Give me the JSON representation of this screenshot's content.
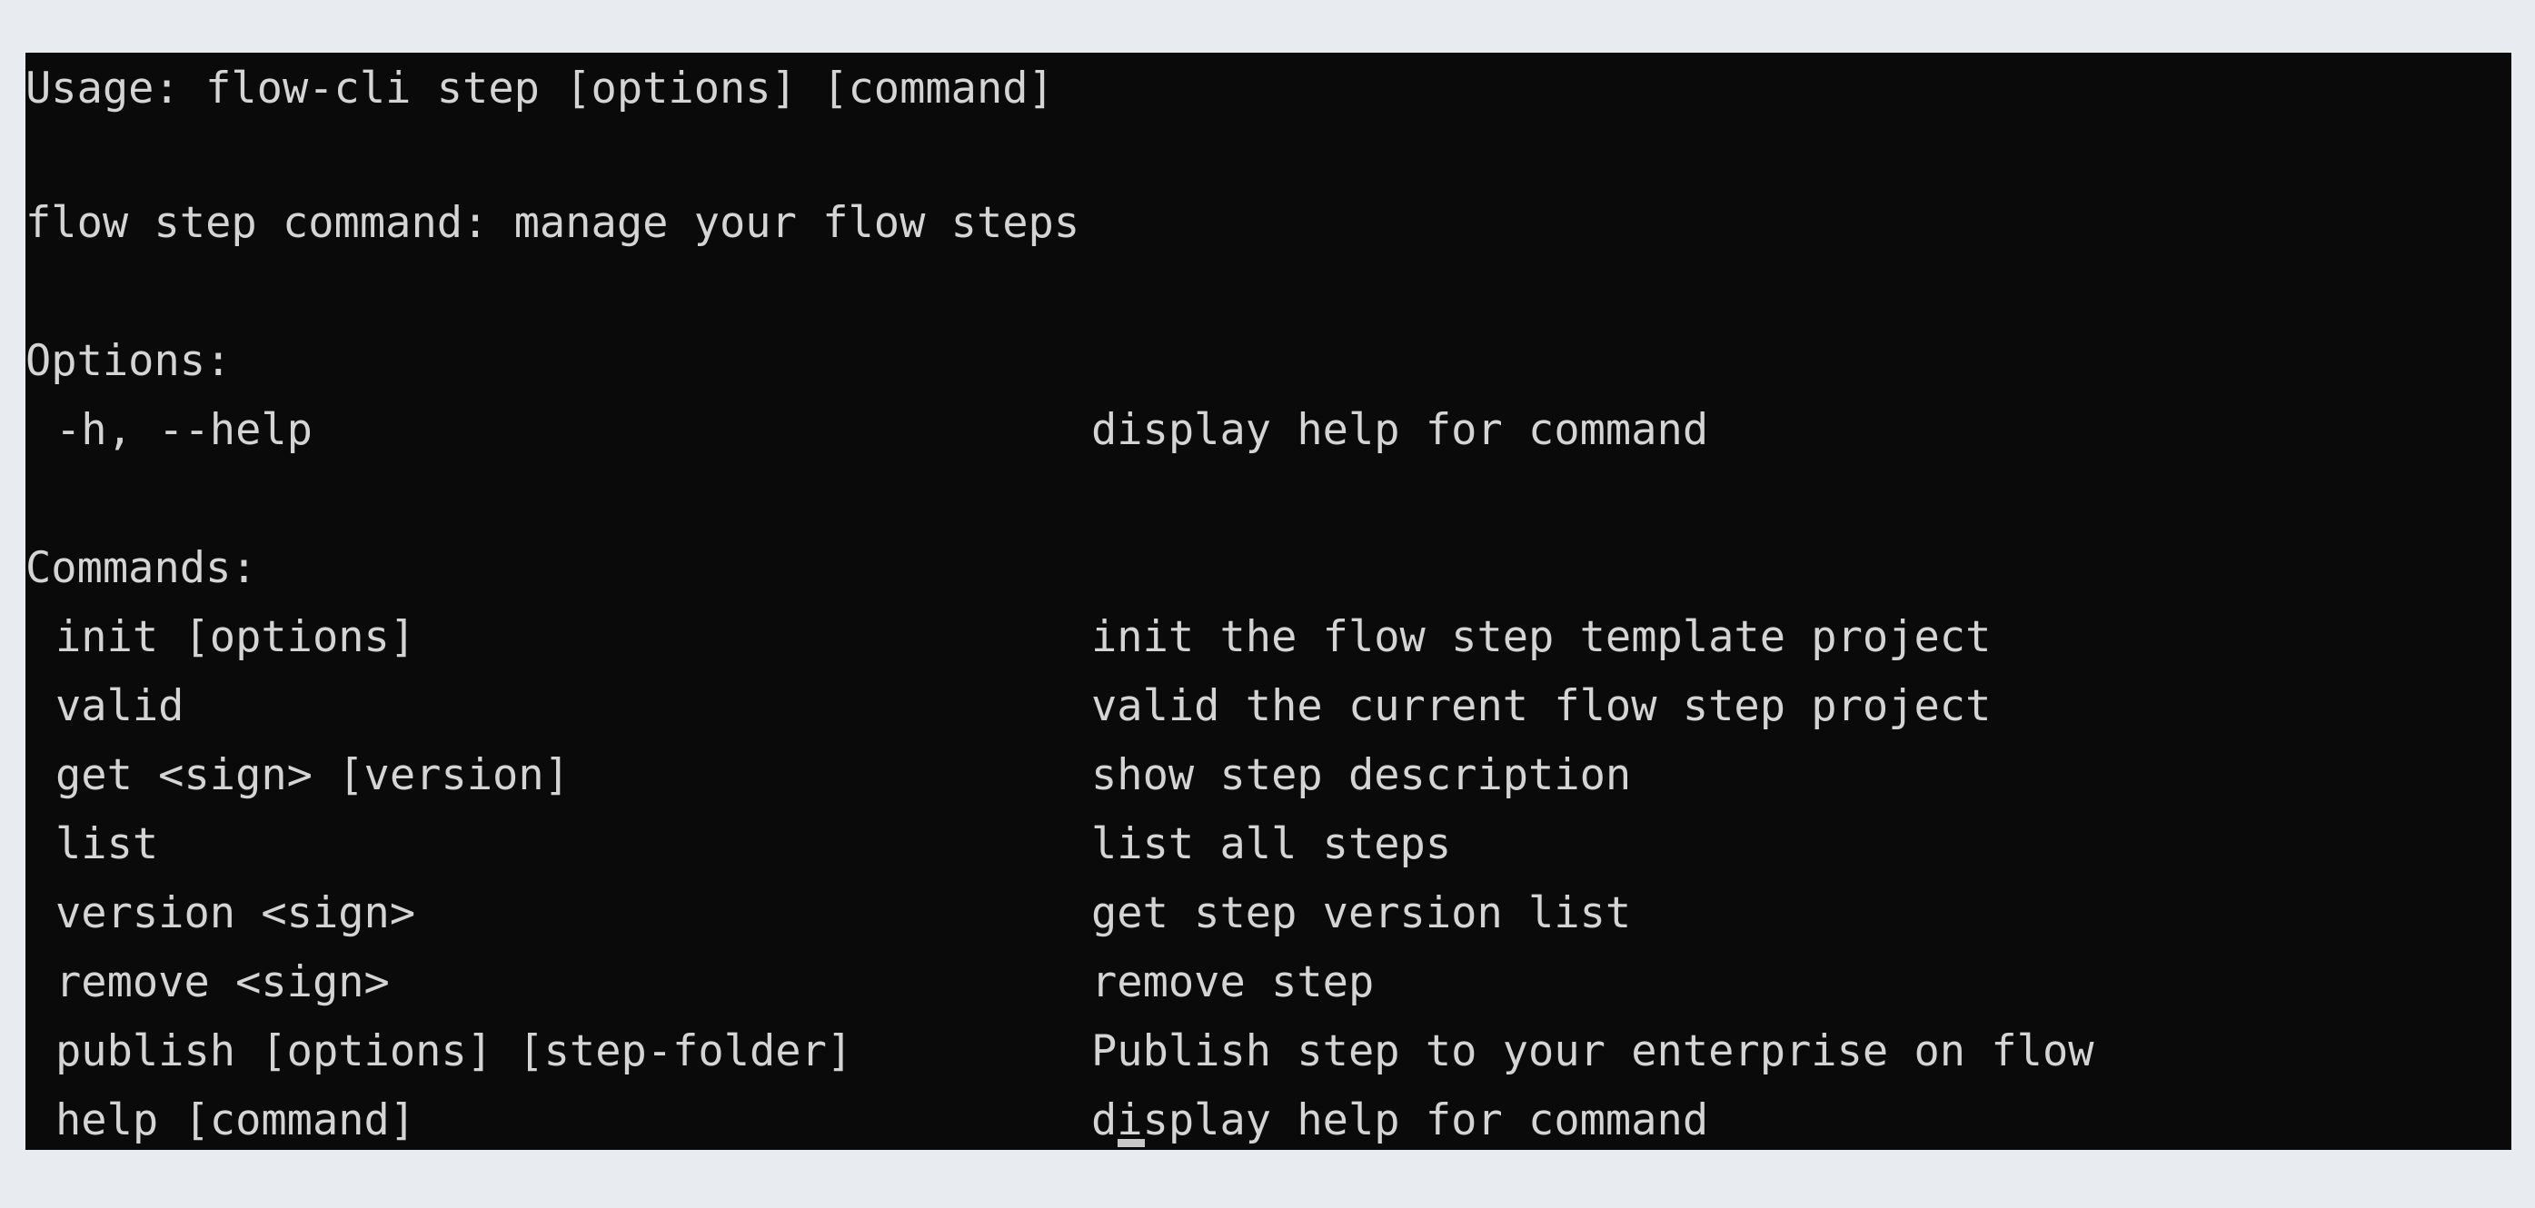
{
  "page": {
    "background_color": "#e8ebef",
    "terminal_background_color": "#0a0a0a",
    "terminal_text_color": "#d4d4d4"
  },
  "terminal": {
    "usage_line": "Usage: flow-cli step [options] [command]",
    "description_line": "flow step command: manage your flow steps",
    "options_heading": "Options:",
    "options": [
      {
        "flag": "-h, --help",
        "description": "display help for command"
      }
    ],
    "commands_heading": "Commands:",
    "commands": [
      {
        "name": "init [options]",
        "description": "init the flow step template project"
      },
      {
        "name": "valid",
        "description": "valid the current flow step project"
      },
      {
        "name": "get <sign> [version]",
        "description": "show step description"
      },
      {
        "name": "list",
        "description": "list all steps"
      },
      {
        "name": "version <sign>",
        "description": "get step version list"
      },
      {
        "name": "remove <sign>",
        "description": "remove step"
      },
      {
        "name": "publish [options] [step-folder]",
        "description": "Publish step to your enterprise on flow"
      },
      {
        "name": "help [command]",
        "description": "display help for command"
      }
    ],
    "cursor": "text-cursor"
  }
}
